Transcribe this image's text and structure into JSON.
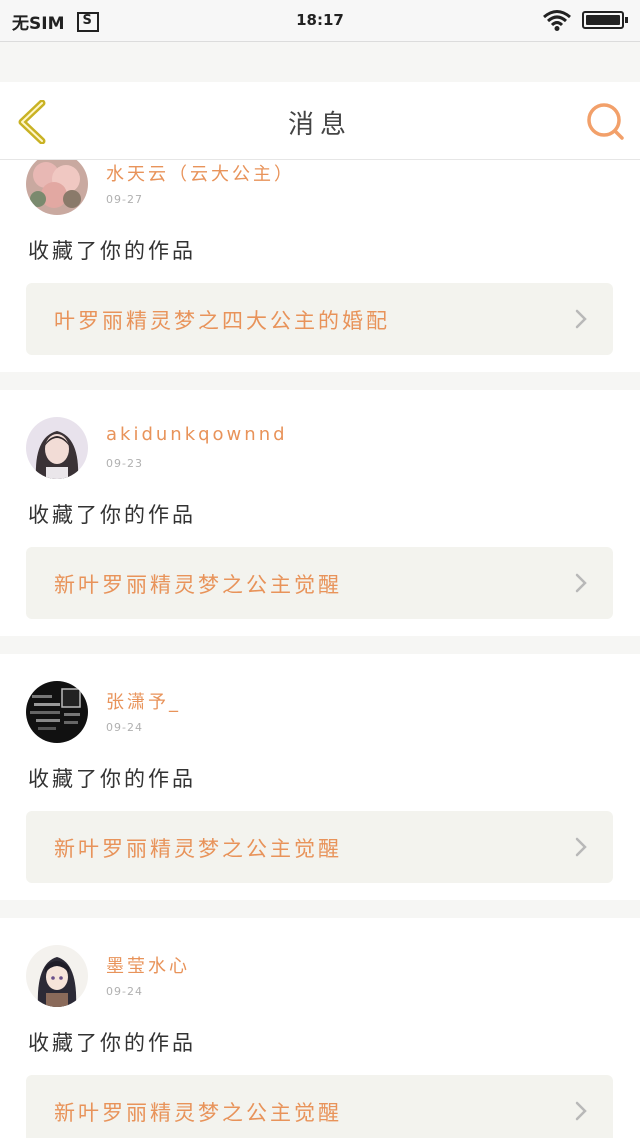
{
  "status_bar": {
    "carrier": "无SIM",
    "sim_icon_label": "S",
    "time": "18:17"
  },
  "header": {
    "title": "消息",
    "back_icon": "chevron-left-icon",
    "search_icon": "search-icon"
  },
  "colors": {
    "accent": "#e8935a",
    "back_icon": "#c9b224",
    "search_icon": "#f2a06a",
    "card_link_bg": "#f3f3ee",
    "page_bg": "#f6f6f4"
  },
  "notifications": [
    {
      "name": "水天云（云大公主）",
      "date": "09-27",
      "action": "收藏了你的作品",
      "work_title": "叶罗丽精灵梦之四大公主的婚配",
      "avatar": "pink-roses-avatar"
    },
    {
      "name": "akidunkqownnd",
      "date": "09-23",
      "action": "收藏了你的作品",
      "work_title": "新叶罗丽精灵梦之公主觉醒",
      "avatar": "girl-avatar"
    },
    {
      "name": "张潇予_",
      "date": "09-24",
      "action": "收藏了你的作品",
      "work_title": "新叶罗丽精灵梦之公主觉醒",
      "avatar": "text-collage-avatar"
    },
    {
      "name": "墨莹水心",
      "date": "09-24",
      "action": "收藏了你的作品",
      "work_title": "新叶罗丽精灵梦之公主觉醒",
      "avatar": "anime-girl-avatar"
    }
  ]
}
